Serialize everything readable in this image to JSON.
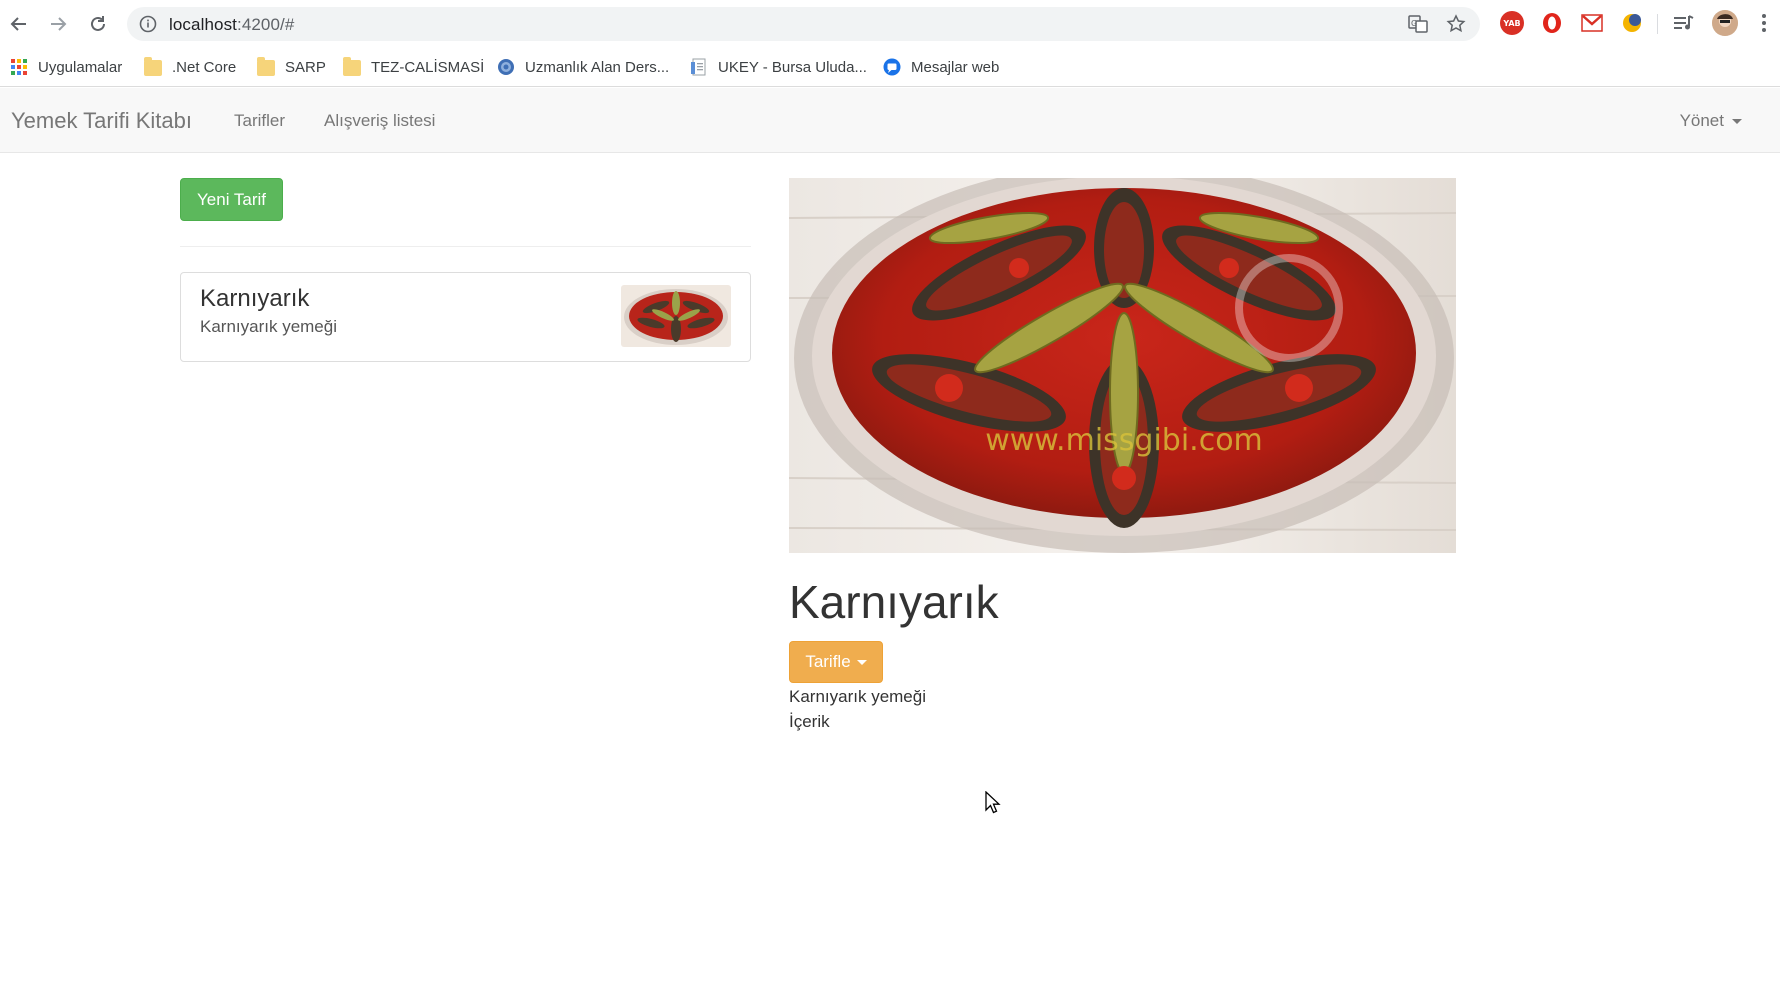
{
  "browser": {
    "url_host": "localhost",
    "url_rest": ":4200/#",
    "nav_icons": [
      "back-arrow-icon",
      "forward-arrow-icon",
      "reload-icon"
    ],
    "extension_icons": [
      "translate-icon",
      "star-icon",
      "yab-extension-icon",
      "opera-extension-icon",
      "gmail-icon",
      "moon-extension-icon",
      "media-control-icon",
      "profile-avatar",
      "kebab-menu-icon"
    ]
  },
  "bookmarks": [
    {
      "label": "Uygulamalar",
      "icon": "apps-grid-icon"
    },
    {
      "label": ".Net Core",
      "icon": "folder-icon"
    },
    {
      "label": "SARP",
      "icon": "folder-icon"
    },
    {
      "label": "TEZ-CALİSMASİ",
      "icon": "folder-icon"
    },
    {
      "label": "Uzmanlık Alan Ders...",
      "icon": "globe-icon"
    },
    {
      "label": "UKEY - Bursa Uluda...",
      "icon": "document-icon"
    },
    {
      "label": "Mesajlar web",
      "icon": "messages-icon"
    }
  ],
  "navbar": {
    "brand": "Yemek Tarifi Kitabı",
    "links": [
      "Tarifler",
      "Alışveriş listesi"
    ],
    "manage": "Yönet"
  },
  "list": {
    "new_button": "Yeni Tarif",
    "items": [
      {
        "title": "Karnıyarık",
        "description": "Karnıyarık yemeği"
      }
    ]
  },
  "detail": {
    "title": "Karnıyarık",
    "action_button": "Tarifle",
    "description": "Karnıyarık yemeği",
    "ingredients_label": "İçerik",
    "image_watermark": "www.missgibi.com"
  },
  "colors": {
    "success": "#5cb85c",
    "warning": "#f0ad4e",
    "navbar_bg": "#f8f8f8"
  }
}
